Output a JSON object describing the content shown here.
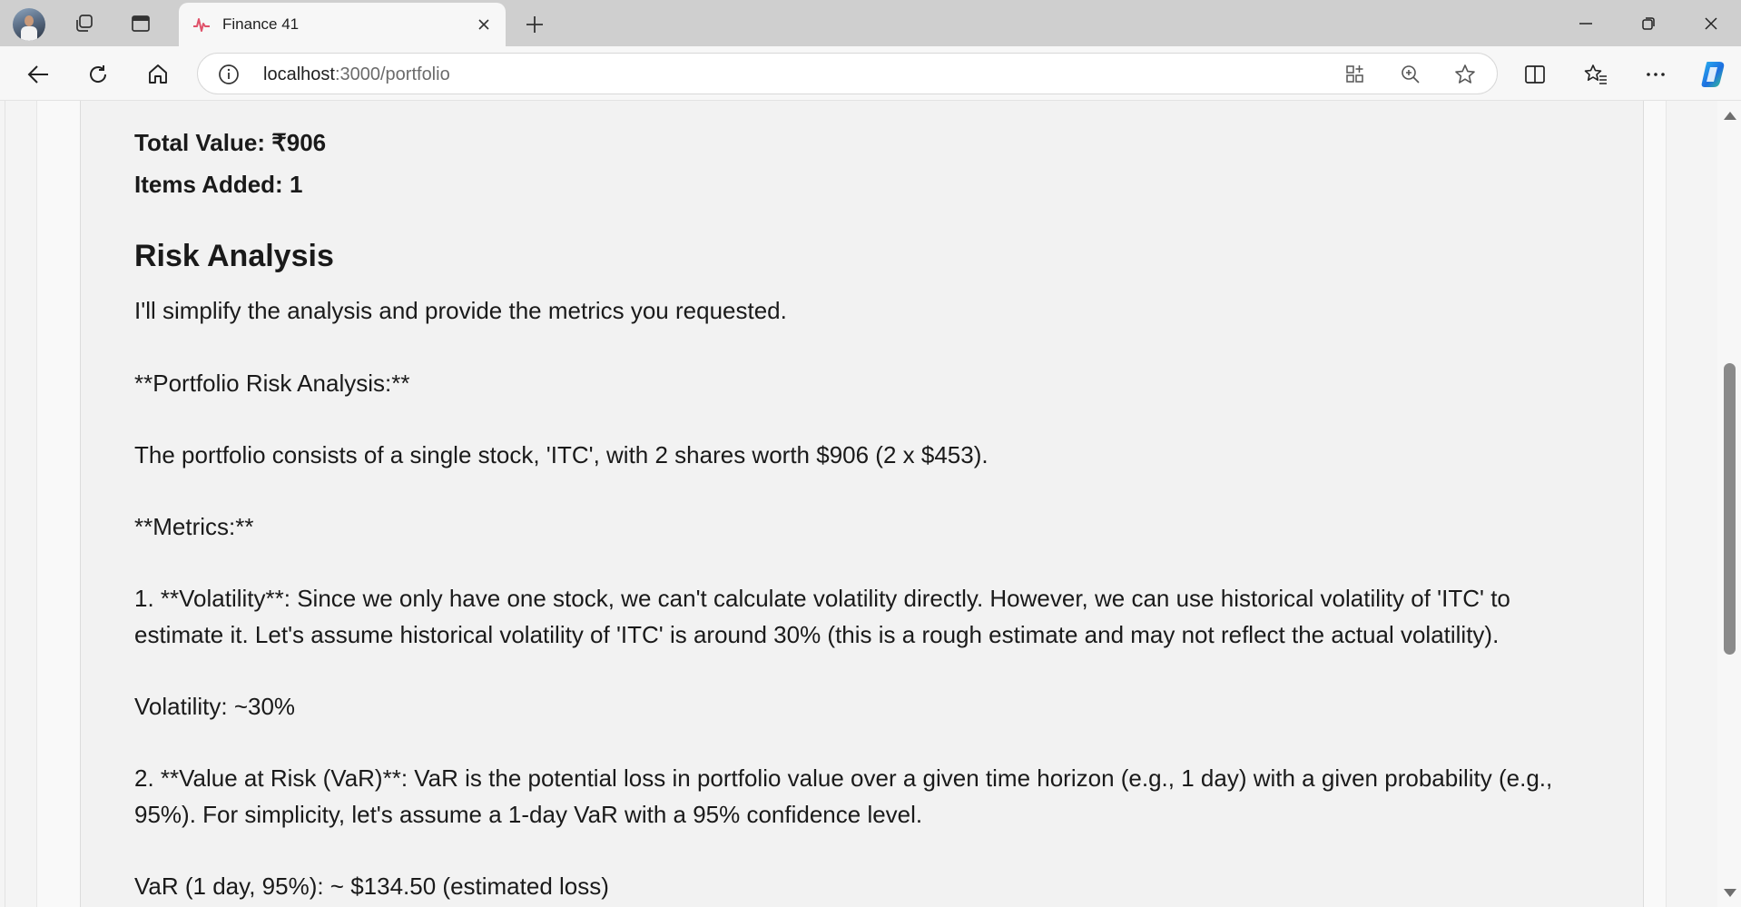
{
  "browser": {
    "tab": {
      "title": "Finance 41"
    },
    "address": {
      "host": "localhost",
      "path": ":3000/portfolio"
    },
    "icons": {
      "profile": "avatar",
      "workspaces": "workspaces-icon",
      "tab_actions": "tab-actions-icon",
      "favicon": "finance-favicon",
      "close_tab": "close-icon",
      "new_tab": "plus-icon",
      "back": "back-arrow-icon",
      "reload": "reload-icon",
      "home": "home-icon",
      "site_info": "info-icon",
      "app_available": "app-grid-icon",
      "zoom": "zoom-icon",
      "favorite": "star-icon",
      "split_screen": "split-screen-icon",
      "favorites_list": "favorites-icon",
      "more": "more-icon",
      "copilot": "copilot-icon"
    }
  },
  "portfolio": {
    "total_value": "Total Value: ₹906",
    "items_added": "Items Added: 1"
  },
  "risk": {
    "heading": "Risk Analysis",
    "paragraphs": [
      "I'll simplify the analysis and provide the metrics you requested.",
      "**Portfolio Risk Analysis:**",
      "The portfolio consists of a single stock, 'ITC', with 2 shares worth $906 (2 x $453).",
      "**Metrics:**",
      "1. **Volatility**: Since we only have one stock, we can't calculate volatility directly. However, we can use historical volatility of 'ITC' to estimate it. Let's assume historical volatility of 'ITC' is around 30% (this is a rough estimate and may not reflect the actual volatility).",
      "Volatility: ~30%",
      "2. **Value at Risk (VaR)**: VaR is the potential loss in portfolio value over a given time horizon (e.g., 1 day) with a given probability (e.g., 95%). For simplicity, let's assume a 1-day VaR with a 95% confidence level.",
      "VaR (1 day, 95%): ~ $134.50 (estimated loss)"
    ]
  },
  "colors": {
    "titlebar": "#cfcfcf",
    "toolbar": "#f7f7f7",
    "copilot_blue": "#1d6fe0",
    "text": "#1a1a1a"
  },
  "scroll_position": 0.45
}
